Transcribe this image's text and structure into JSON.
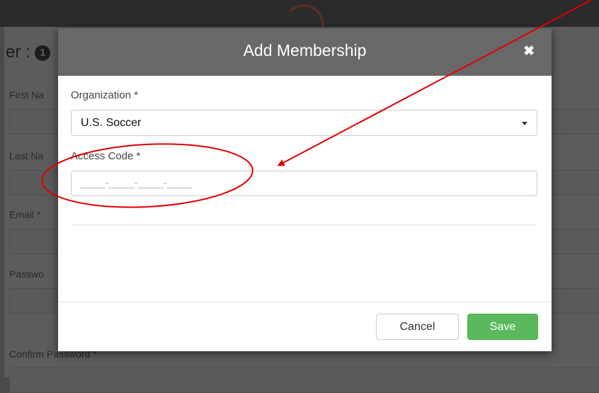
{
  "background": {
    "heading_prefix": "er :",
    "step_badge": "1",
    "fields": {
      "first_name": "First Na",
      "last_name": "Last Na",
      "email": "Email *",
      "password": "Passwo",
      "confirm_password": "Confirm Password *"
    }
  },
  "modal": {
    "title": "Add Membership",
    "close_glyph": "✖",
    "organization_label": "Organization *",
    "organization_value": "U.S. Soccer",
    "access_code_label": "Access Code *",
    "access_code_value": "",
    "access_code_placeholder": "____-____-____-____",
    "cancel_label": "Cancel",
    "save_label": "Save"
  },
  "colors": {
    "header": "#686868",
    "save_button": "#5cb85c",
    "annotation": "#e00000"
  }
}
